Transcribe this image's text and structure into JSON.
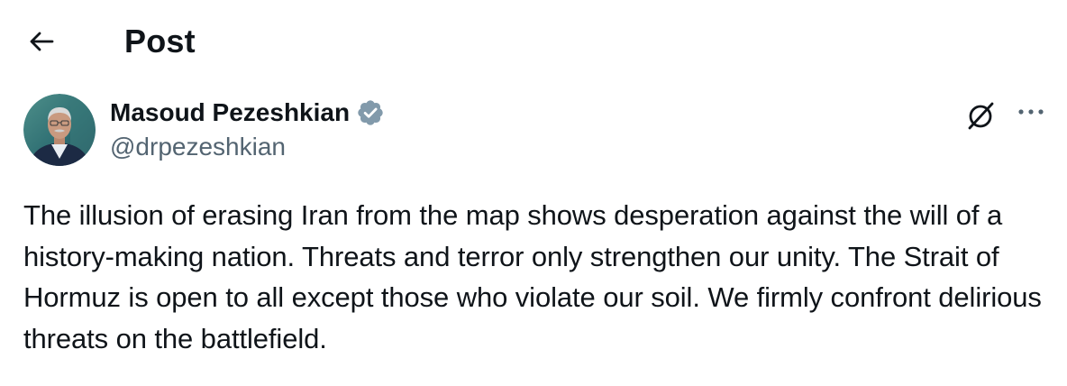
{
  "header": {
    "title": "Post",
    "back_icon": "arrow-left-icon"
  },
  "author": {
    "name": "Masoud Pezeshkian",
    "handle": "@drpezeshkian",
    "verified": true,
    "verified_badge_color": "#829aab",
    "avatar_icon": "profile-photo"
  },
  "actions": {
    "grok_icon": "grok-icon",
    "more_icon": "more-horizontal-icon"
  },
  "post": {
    "text": "The illusion of erasing Iran from the map shows desperation against the will of a history-making nation. Threats and terror only strengthen our unity. The Strait of Hormuz is open to all except those who violate our soil. We firmly confront delirious threats on the battlefield."
  },
  "colors": {
    "text_primary": "#0f1419",
    "text_secondary": "#536471",
    "background": "#ffffff"
  }
}
